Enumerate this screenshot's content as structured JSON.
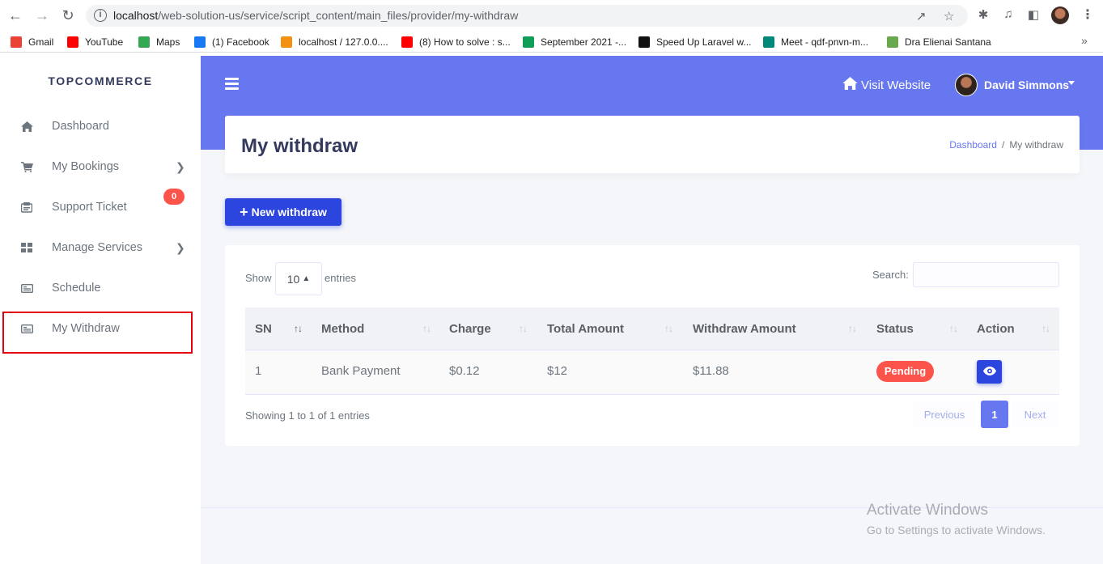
{
  "browser": {
    "url_host": "localhost",
    "url_path": "/web-solution-us/service/script_content/main_files/provider/my-withdraw",
    "bookmarks": [
      {
        "label": "Gmail",
        "icon": "gmail-icon",
        "color": "#ea4335"
      },
      {
        "label": "YouTube",
        "icon": "youtube-icon",
        "color": "#ff0000"
      },
      {
        "label": "Maps",
        "icon": "maps-icon",
        "color": "#34a853"
      },
      {
        "label": "(1) Facebook",
        "icon": "facebook-icon",
        "color": "#1877f2"
      },
      {
        "label": "localhost / 127.0.0....",
        "icon": "phpmyadmin-icon",
        "color": "#f29111"
      },
      {
        "label": "(8) How to solve : s...",
        "icon": "youtube-icon",
        "color": "#ff0000"
      },
      {
        "label": "September 2021 -...",
        "icon": "sheets-icon",
        "color": "#0f9d58"
      },
      {
        "label": "Speed Up Laravel w...",
        "icon": "laravel-icon",
        "color": "#111111"
      },
      {
        "label": "Meet - qdf-pnvn-m...",
        "icon": "meet-icon",
        "color": "#00897b"
      },
      {
        "label": "Dra Elienai Santana",
        "icon": "site-icon",
        "color": "#6aa84f"
      }
    ]
  },
  "sidebar": {
    "brand": "TOPCOMMERCE",
    "items": [
      {
        "label": "Dashboard",
        "icon": "home-icon",
        "chevron": false
      },
      {
        "label": "My Bookings",
        "icon": "cart-icon",
        "chevron": true
      },
      {
        "label": "Support Ticket",
        "icon": "ticket-icon",
        "badge": "0"
      },
      {
        "label": "Manage Services",
        "icon": "grid-icon",
        "chevron": true
      },
      {
        "label": "Schedule",
        "icon": "card-icon",
        "chevron": false
      },
      {
        "label": "My Withdraw",
        "icon": "card-icon",
        "chevron": false
      }
    ]
  },
  "topbar": {
    "visit_label": "Visit Website",
    "user_name": "David Simmons"
  },
  "header": {
    "title": "My withdraw",
    "breadcrumb": [
      "Dashboard",
      "My withdraw"
    ]
  },
  "actions": {
    "new_withdraw_label": "New withdraw"
  },
  "table": {
    "show_label": "Show",
    "page_size": "10",
    "entries_label": "entries",
    "search_label": "Search:",
    "search_value": "",
    "columns": [
      "SN",
      "Method",
      "Charge",
      "Total Amount",
      "Withdraw Amount",
      "Status",
      "Action"
    ],
    "rows": [
      {
        "sn": "1",
        "method": "Bank Payment",
        "charge": "$0.12",
        "total": "$12",
        "withdraw": "$11.88",
        "status": "Pending"
      }
    ],
    "info": "Showing 1 to 1 of 1 entries",
    "pagination": {
      "previous": "Previous",
      "current": "1",
      "next": "Next"
    }
  },
  "watermark": {
    "line1": "Activate Windows",
    "line2": "Go to Settings to activate Windows."
  },
  "colors": {
    "primary": "#6777ef",
    "button": "#2b45de",
    "danger": "#fc544b"
  }
}
